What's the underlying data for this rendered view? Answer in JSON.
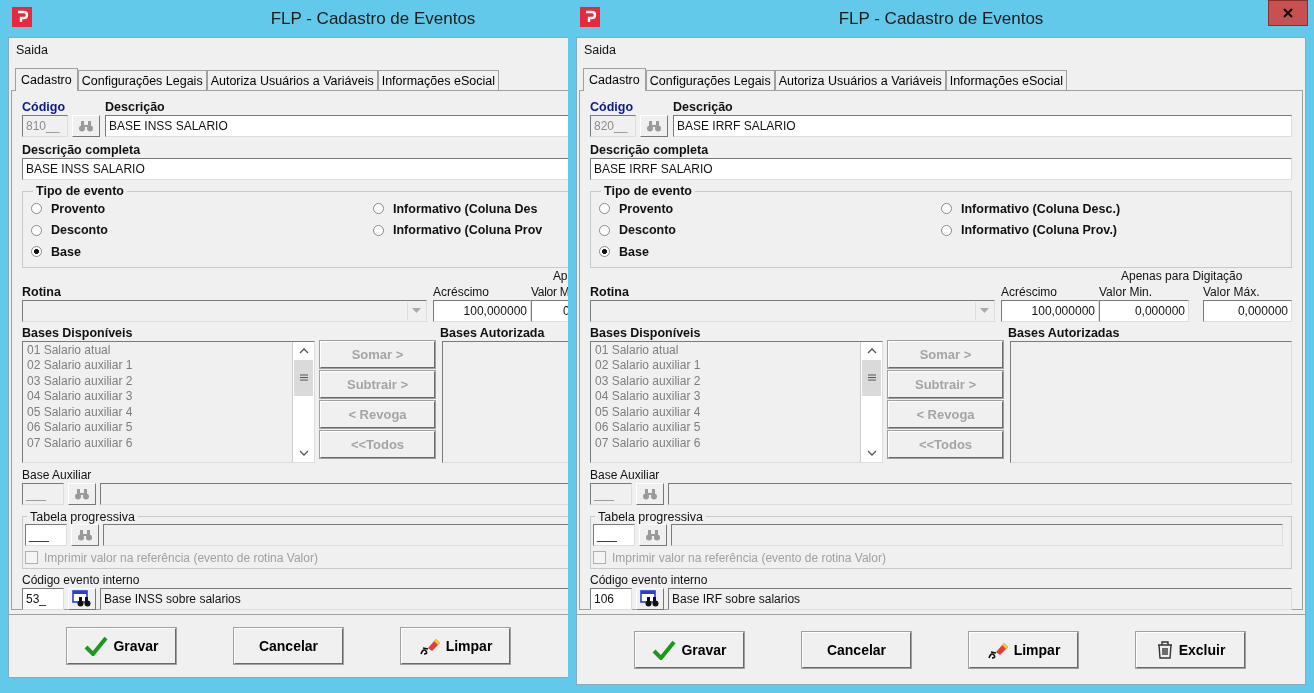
{
  "windows": [
    {
      "title": "FLP - Cadastro de Eventos",
      "menu": [
        {
          "label": "Saida"
        }
      ],
      "tabs": [
        {
          "label": "Cadastro",
          "selected": true
        },
        {
          "label": "Configurações Legais",
          "selected": false
        },
        {
          "label": "Autoriza Usuários a Variáveis",
          "selected": false
        },
        {
          "label": "Informações eSocial",
          "selected": false
        }
      ],
      "codigo": {
        "label": "Código",
        "value": "810__",
        "disabled": true
      },
      "descricao": {
        "label": "Descrição",
        "value": "BASE INSS SALARIO"
      },
      "descricao_completa": {
        "label": "Descrição completa",
        "value": "BASE INSS SALARIO"
      },
      "tipo_evento": {
        "label": "Tipo de evento",
        "options": [
          {
            "label": "Provento",
            "selected": false
          },
          {
            "label": "Desconto",
            "selected": false
          },
          {
            "label": "Base",
            "selected": true
          },
          {
            "label": "Informativo (Coluna Des",
            "selected": false
          },
          {
            "label": "Informativo (Coluna Prov",
            "selected": false
          }
        ]
      },
      "rotina": {
        "label": "Rotina"
      },
      "acrescimo": {
        "label": "Acréscimo",
        "value": "100,000000"
      },
      "digitacao_label": "Ap",
      "valor_min": {
        "label": "Valor M",
        "value": "0"
      },
      "bases_disponiveis": {
        "label": "Bases Disponíveis",
        "items": [
          "01 Salario atual",
          "02 Salario auxiliar 1",
          "03 Salario auxiliar 2",
          "04 Salario auxiliar 3",
          "05 Salario auxiliar 4",
          "06 Salario auxiliar 5",
          "07 Salario auxiliar 6"
        ]
      },
      "list_buttons": [
        {
          "label": "Somar >",
          "disabled": true
        },
        {
          "label": "Subtrair >",
          "disabled": true
        },
        {
          "label": "< Revoga",
          "disabled": true
        },
        {
          "label": "<<Todos",
          "disabled": true
        }
      ],
      "bases_autorizadas": {
        "label": "Bases Autorizada"
      },
      "base_auxiliar": {
        "label": "Base Auxiliar",
        "value": "___",
        "disabled": true
      },
      "tabela_progressiva": {
        "label": "Tabela progressiva",
        "value": "___",
        "disabled": false,
        "checkbox": {
          "label": "Imprimir valor na referência (evento de rotina Valor)",
          "checked": false,
          "disabled": true
        }
      },
      "codigo_interno": {
        "label": "Código evento interno",
        "code": "53_",
        "description": "Base INSS sobre salarios"
      },
      "buttons": [
        {
          "label": "Gravar",
          "kind": "save"
        },
        {
          "label": "Cancelar",
          "kind": "cancel"
        },
        {
          "label": "Limpar",
          "kind": "clear"
        }
      ]
    },
    {
      "title": "FLP - Cadastro de Eventos",
      "close_button": true,
      "menu": [
        {
          "label": "Saida"
        }
      ],
      "tabs": [
        {
          "label": "Cadastro",
          "selected": true
        },
        {
          "label": "Configurações Legais",
          "selected": false
        },
        {
          "label": "Autoriza Usuários a Variáveis",
          "selected": false
        },
        {
          "label": "Informações eSocial",
          "selected": false
        }
      ],
      "codigo": {
        "label": "Código",
        "value": "820__",
        "disabled": true
      },
      "descricao": {
        "label": "Descrição",
        "value": "BASE IRRF SALARIO"
      },
      "descricao_completa": {
        "label": "Descrição completa",
        "value": "BASE IRRF SALARIO"
      },
      "tipo_evento": {
        "label": "Tipo de evento",
        "options": [
          {
            "label": "Provento",
            "selected": false
          },
          {
            "label": "Desconto",
            "selected": false
          },
          {
            "label": "Base",
            "selected": true
          },
          {
            "label": "Informativo (Coluna Desc.)",
            "selected": false
          },
          {
            "label": "Informativo (Coluna Prov.)",
            "selected": false
          }
        ]
      },
      "rotina": {
        "label": "Rotina"
      },
      "acrescimo": {
        "label": "Acréscimo",
        "value": "100,000000"
      },
      "digitacao_label": "Apenas para Digitação",
      "valor_min": {
        "label": "Valor Min.",
        "value": "0,000000"
      },
      "valor_max": {
        "label": "Valor Máx.",
        "value": "0,000000"
      },
      "bases_disponiveis": {
        "label": "Bases Disponíveis",
        "items": [
          "01 Salario atual",
          "02 Salario auxiliar 1",
          "03 Salario auxiliar 2",
          "04 Salario auxiliar 3",
          "05 Salario auxiliar 4",
          "06 Salario auxiliar 5",
          "07 Salario auxiliar 6"
        ]
      },
      "list_buttons": [
        {
          "label": "Somar >",
          "disabled": true
        },
        {
          "label": "Subtrair >",
          "disabled": true
        },
        {
          "label": "< Revoga",
          "disabled": true
        },
        {
          "label": "<<Todos",
          "disabled": true
        }
      ],
      "bases_autorizadas": {
        "label": "Bases Autorizadas"
      },
      "base_auxiliar": {
        "label": "Base Auxiliar",
        "value": "___",
        "disabled": true
      },
      "tabela_progressiva": {
        "label": "Tabela progressiva",
        "value": "___",
        "disabled": false,
        "checkbox": {
          "label": "Imprimir valor na referência (evento de rotina Valor)",
          "checked": false,
          "disabled": true
        }
      },
      "codigo_interno": {
        "label": "Código evento interno",
        "code": "106",
        "description": "Base IRF sobre salarios"
      },
      "buttons": [
        {
          "label": "Gravar",
          "kind": "save"
        },
        {
          "label": "Cancelar",
          "kind": "cancel"
        },
        {
          "label": "Limpar",
          "kind": "clear"
        },
        {
          "label": "Excluir",
          "kind": "delete"
        }
      ]
    }
  ]
}
